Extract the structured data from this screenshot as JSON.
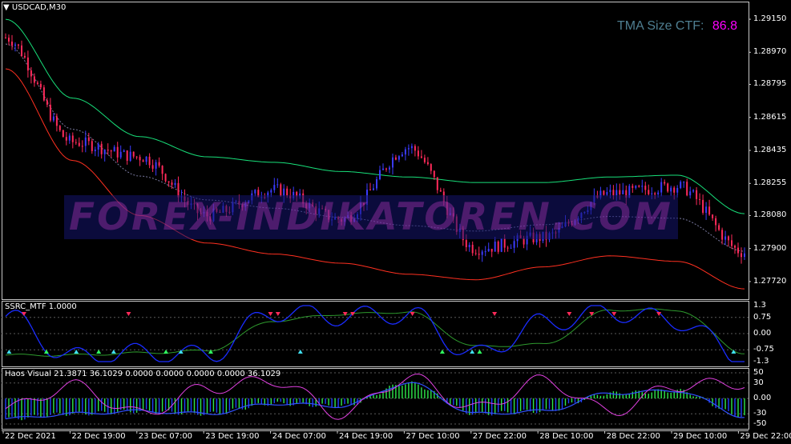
{
  "symbol": "USDCAD,M30",
  "tma": {
    "label": "TMA Size CTF:",
    "value": "86.8",
    "label_color": "#4f7f92",
    "value_color": "#ff00ff"
  },
  "watermark": "FOREX-INDIKATOREN.COM",
  "colors": {
    "up_candle": "#3b3bff",
    "down_candle": "#ff2a5a",
    "upper_band": "#18e07a",
    "lower_band": "#ff3020",
    "mid_line": "#7a7aa0",
    "frame": "#c8c8c8",
    "ssrc_main": "#1a2cff",
    "ssrc_signal": "#2e9a2e",
    "haos_green": "#2ee84a",
    "haos_magenta": "#e040e0"
  },
  "main_axis": {
    "ticks": [
      "1.29150",
      "1.28970",
      "1.28795",
      "1.28615",
      "1.28435",
      "1.28255",
      "1.28080",
      "1.27900",
      "1.27720"
    ],
    "values": [
      1.2915,
      1.2897,
      1.28795,
      1.28615,
      1.28435,
      1.28255,
      1.2808,
      1.279,
      1.2772
    ]
  },
  "x_axis": {
    "ticks": [
      "22 Dec 2021",
      "22 Dec 19:00",
      "23 Dec 07:00",
      "23 Dec 19:00",
      "24 Dec 07:00",
      "24 Dec 19:00",
      "27 Dec 10:00",
      "27 Dec 22:00",
      "28 Dec 10:00",
      "28 Dec 22:00",
      "29 Dec 10:00",
      "29 Dec 22:00"
    ]
  },
  "ssrc": {
    "title": "SSRC_MTF 1.0000",
    "ticks": [
      "1.3",
      "0.75",
      "0.00",
      "-0.75",
      "-1.3"
    ],
    "values": [
      1.3,
      0.75,
      0.0,
      -0.75,
      -1.3
    ]
  },
  "haos": {
    "title": "Haos Visual 21.3871 36.1029 0.0000 0.0000 0.0000 0.0000 36.1029",
    "ticks": [
      "50",
      "30",
      "0.00",
      "-30",
      "-50"
    ],
    "values": [
      50,
      30,
      0,
      -30,
      -50
    ]
  },
  "chart_data": [
    {
      "type": "candlestick",
      "title": "USDCAD,M30",
      "ylim": [
        1.2765,
        1.2922
      ],
      "x": [
        "22 Dec 2021",
        "22 Dec 19:00",
        "23 Dec 07:00",
        "23 Dec 19:00",
        "24 Dec 07:00",
        "24 Dec 19:00",
        "27 Dec 10:00",
        "27 Dec 22:00",
        "28 Dec 10:00",
        "28 Dec 22:00",
        "29 Dec 10:00",
        "29 Dec 22:00"
      ],
      "close": [
        1.2905,
        1.2848,
        1.284,
        1.2808,
        1.2822,
        1.2806,
        1.2845,
        1.279,
        1.2796,
        1.282,
        1.2824,
        1.2788
      ],
      "upper_band": [
        1.2915,
        1.2872,
        1.2851,
        1.284,
        1.2837,
        1.2832,
        1.2829,
        1.2826,
        1.2826,
        1.2829,
        1.283,
        1.2809
      ],
      "lower_band": [
        1.2888,
        1.2838,
        1.2808,
        1.2793,
        1.2787,
        1.2782,
        1.2776,
        1.2773,
        1.278,
        1.2786,
        1.2783,
        1.2768
      ]
    },
    {
      "type": "line",
      "title": "SSRC_MTF 1.0000",
      "ylim": [
        -1.3,
        1.3
      ],
      "x": [
        "22 Dec 2021",
        "22 Dec 19:00",
        "23 Dec 07:00",
        "23 Dec 19:00",
        "24 Dec 07:00",
        "24 Dec 19:00",
        "27 Dec 10:00",
        "27 Dec 22:00",
        "28 Dec 10:00",
        "28 Dec 22:00",
        "29 Dec 10:00",
        "29 Dec 22:00"
      ],
      "series": [
        {
          "values": [
            0.8,
            -1.1,
            -0.9,
            -1.0,
            1.0,
            0.8,
            0.9,
            -1.0,
            0.5,
            1.0,
            0.6,
            -1.2
          ]
        },
        {
          "values": [
            -1.0,
            -1.0,
            -0.9,
            -0.8,
            0.6,
            0.9,
            1.0,
            -0.6,
            -0.5,
            1.1,
            1.1,
            -0.9
          ]
        }
      ]
    },
    {
      "type": "bar",
      "title": "Haos Visual 21.3871 36.1029 0.0000 0.0000 0.0000 0.0000 36.1029",
      "ylim": [
        -50,
        50
      ],
      "x": [
        "22 Dec 2021",
        "22 Dec 19:00",
        "23 Dec 07:00",
        "23 Dec 19:00",
        "24 Dec 07:00",
        "24 Dec 19:00",
        "27 Dec 10:00",
        "27 Dec 22:00",
        "28 Dec 10:00",
        "28 Dec 22:00",
        "29 Dec 10:00",
        "29 Dec 22:00"
      ],
      "series": [
        {
          "values": [
            -40,
            -30,
            -25,
            -30,
            -10,
            -15,
            30,
            -30,
            -25,
            10,
            15,
            -35
          ]
        },
        {
          "values": [
            -20,
            25,
            -30,
            20,
            35,
            -30,
            40,
            -20,
            35,
            -25,
            25,
            30
          ]
        }
      ]
    }
  ]
}
